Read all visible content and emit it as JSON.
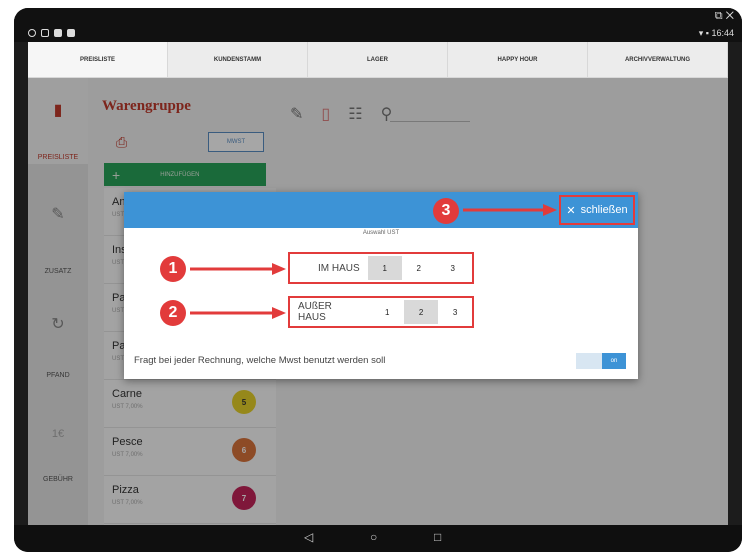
{
  "status_bar": {
    "time": "16:44",
    "window_controls": "⧉ ✕"
  },
  "tabs": [
    {
      "label": "PREISLISTE",
      "active": true
    },
    {
      "label": "KUNDENSTAMM",
      "active": false
    },
    {
      "label": "LAGER",
      "active": false
    },
    {
      "label": "HAPPY HOUR",
      "active": false
    },
    {
      "label": "ARCHIVVERWALTUNG",
      "active": false
    }
  ],
  "sidebar": {
    "items": [
      {
        "label": "PREISLISTE",
        "icon": "price-list-icon"
      },
      {
        "label": "ZUSATZ",
        "icon": "pencil-icon"
      },
      {
        "label": "PFAND",
        "icon": "deposit-icon"
      },
      {
        "label": "GEBÜHR",
        "icon": "fee-icon"
      }
    ]
  },
  "main": {
    "group_title": "Warengruppe",
    "mwst_button": "MWST",
    "add_button": "HINZUFÜGEN"
  },
  "items": [
    {
      "name": "Antip",
      "ust": "UST 1"
    },
    {
      "name": "Insal",
      "ust": "UST 1"
    },
    {
      "name": "Past",
      "ust": "UST 7"
    },
    {
      "name": "Past",
      "ust": "UST 7"
    },
    {
      "name": "Carne",
      "ust": "UST 7,00%",
      "badge": "5",
      "color": "#e6d22a"
    },
    {
      "name": "Pesce",
      "ust": "UST 7,00%",
      "badge": "6",
      "color": "#d9733b"
    },
    {
      "name": "Pizza",
      "ust": "UST 7,00%",
      "badge": "7",
      "color": "#c3245a"
    }
  ],
  "dialog": {
    "subtitle": "Auswahl UST",
    "close_label": "schließen",
    "im_haus": {
      "label": "IM HAUS",
      "options": [
        "1",
        "2",
        "3"
      ],
      "selected": "1"
    },
    "ausser_haus": {
      "label": "AUßER HAUS",
      "options": [
        "1",
        "2",
        "3"
      ],
      "selected": "2"
    },
    "note": "Fragt bei jeder Rechnung, welche Mwst benutzt werden soll",
    "toggle_label": "on"
  },
  "annotations": {
    "n1": "1",
    "n2": "2",
    "n3": "3"
  },
  "colors": {
    "accent_blue": "#3d93d6",
    "annotation_red": "#e23b3b",
    "add_green": "#29a35a"
  }
}
